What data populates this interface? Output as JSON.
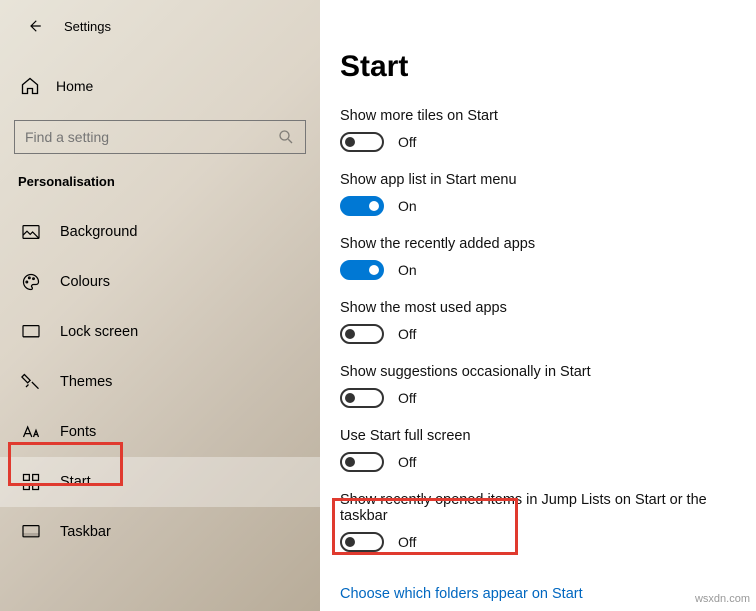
{
  "app": {
    "title": "Settings"
  },
  "home": {
    "label": "Home"
  },
  "search": {
    "placeholder": "Find a setting"
  },
  "section": "Personalisation",
  "nav": [
    {
      "label": "Background"
    },
    {
      "label": "Colours"
    },
    {
      "label": "Lock screen"
    },
    {
      "label": "Themes"
    },
    {
      "label": "Fonts"
    },
    {
      "label": "Start"
    },
    {
      "label": "Taskbar"
    }
  ],
  "page": {
    "title": "Start"
  },
  "settings": [
    {
      "label": "Show more tiles on Start",
      "on": false,
      "state": "Off"
    },
    {
      "label": "Show app list in Start menu",
      "on": true,
      "state": "On"
    },
    {
      "label": "Show the recently added apps",
      "on": true,
      "state": "On"
    },
    {
      "label": "Show the most used apps",
      "on": false,
      "state": "Off"
    },
    {
      "label": "Show suggestions occasionally in Start",
      "on": false,
      "state": "Off"
    },
    {
      "label": "Use Start full screen",
      "on": false,
      "state": "Off"
    },
    {
      "label": "Show recently opened items in Jump Lists on Start or the taskbar",
      "on": false,
      "state": "Off"
    }
  ],
  "link": "Choose which folders appear on Start",
  "watermark": "wsxdn.com"
}
